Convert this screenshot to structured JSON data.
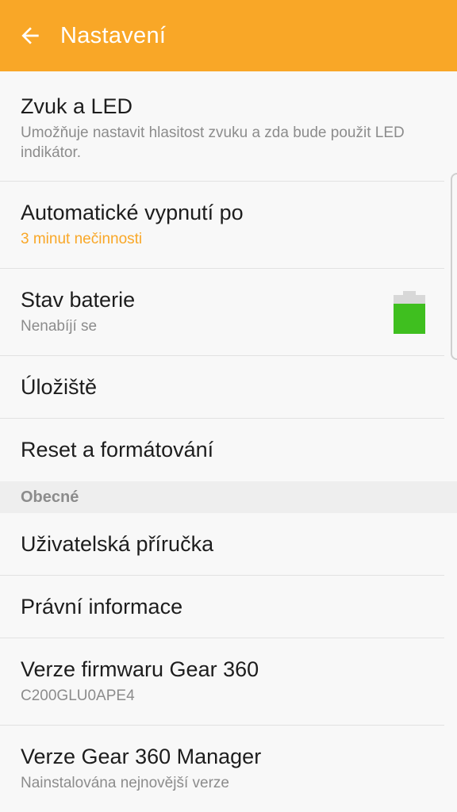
{
  "appbar": {
    "title": "Nastavení",
    "color": "#f9a727"
  },
  "items": {
    "sound": {
      "title": "Zvuk a LED",
      "subtitle": "Umožňuje nastavit hlasitost zvuku a zda bude použit LED indikátor."
    },
    "auto_off": {
      "title": "Automatické vypnutí po",
      "subtitle": "3 minut nečinnosti"
    },
    "battery": {
      "title": "Stav baterie",
      "subtitle": "Nenabíjí se",
      "level_fraction": 0.78,
      "fill_color": "#3fbf1f"
    },
    "storage": {
      "title": "Úložiště"
    },
    "reset": {
      "title": "Reset a formátování"
    }
  },
  "section_general": {
    "label": "Obecné"
  },
  "general_items": {
    "manual": {
      "title": "Uživatelská příručka"
    },
    "legal": {
      "title": "Právní informace"
    },
    "firmware": {
      "title": "Verze firmwaru Gear 360",
      "subtitle": "C200GLU0APE4"
    },
    "manager": {
      "title": "Verze Gear 360 Manager",
      "subtitle": "Nainstalována nejnovější verze"
    }
  },
  "icons": {
    "back": "arrow-left-icon",
    "battery": "battery-icon"
  }
}
